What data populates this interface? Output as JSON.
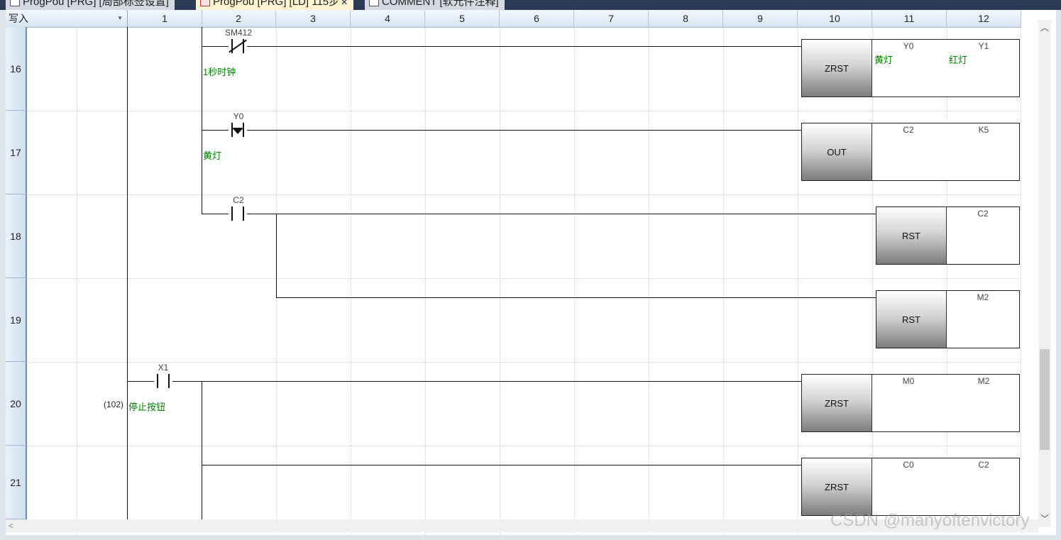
{
  "tabs": [
    {
      "label": "ProgPou [PRG] [局部标签设置]"
    },
    {
      "label": "ProgPou [PRG] [LD] 115步"
    },
    {
      "label": "COMMENT [软元件注释]"
    }
  ],
  "mode": "写入",
  "columns": [
    "1",
    "2",
    "3",
    "4",
    "5",
    "6",
    "7",
    "8",
    "9",
    "10",
    "11",
    "12"
  ],
  "rows": [
    {
      "num": "16",
      "contact_device": "SM412",
      "contact_comment": "1秒时钟",
      "instruction": "ZRST",
      "operand1": "Y0",
      "operand1_comment": "黄灯",
      "operand2": "Y1",
      "operand2_comment": "红灯"
    },
    {
      "num": "17",
      "contact_device": "Y0",
      "contact_comment": "黄灯",
      "instruction": "OUT",
      "operand1": "C2",
      "operand2": "K5"
    },
    {
      "num": "18",
      "contact_device": "C2",
      "instruction": "RST",
      "operand1": "C2"
    },
    {
      "num": "19",
      "instruction": "RST",
      "operand1": "M2"
    },
    {
      "num": "20",
      "step": "(102)",
      "contact_device": "X1",
      "contact_comment": "停止按钮",
      "instruction": "ZRST",
      "operand1": "M0",
      "operand2": "M2"
    },
    {
      "num": "21",
      "instruction": "ZRST",
      "operand1": "C0",
      "operand2": "C2"
    }
  ],
  "watermark": "CSDN @manyoftenvictory",
  "icons": {
    "scroll_up": "chevron-up-icon",
    "scroll_down": "chevron-down-icon",
    "scroll_left": "chevron-left-icon",
    "tab_close": "close-icon"
  }
}
